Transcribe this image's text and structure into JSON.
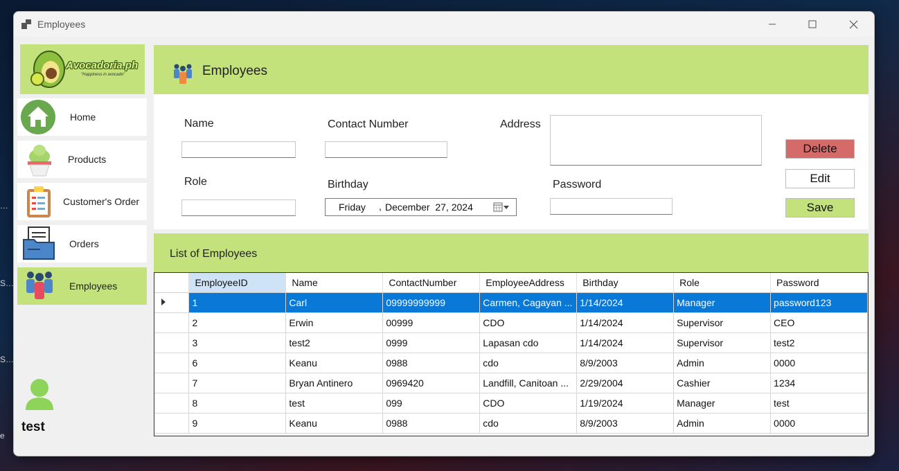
{
  "window": {
    "title": "Employees"
  },
  "sidebar": {
    "logo": {
      "brand": "Avocadoria.ph",
      "tagline": "\"Happiness in avocado\""
    },
    "items": [
      {
        "label": "Home",
        "icon": "home-icon"
      },
      {
        "label": "Products",
        "icon": "ice-cream-icon"
      },
      {
        "label": "Customer's Order",
        "icon": "clipboard-icon"
      },
      {
        "label": "Orders",
        "icon": "folder-icon"
      },
      {
        "label": "Employees",
        "icon": "people-icon",
        "active": true
      }
    ],
    "user": {
      "name": "test"
    }
  },
  "header": {
    "title": "Employees"
  },
  "form": {
    "name_label": "Name",
    "name_value": "",
    "contact_label": "Contact Number",
    "contact_value": "",
    "address_label": "Address",
    "address_value": "",
    "role_label": "Role",
    "role_value": "",
    "birthday_label": "Birthday",
    "birthday_day": "Friday",
    "birthday_sep": ",",
    "birthday_date": "December  27, 2024",
    "password_label": "Password",
    "password_value": "",
    "delete_label": "Delete",
    "edit_label": "Edit",
    "save_label": "Save"
  },
  "list": {
    "title": "List of Employees",
    "columns": [
      "EmployeeID",
      "Name",
      "ContactNumber",
      "EmployeeAddress",
      "Birthday",
      "Role",
      "Password"
    ],
    "rows": [
      [
        "1",
        "Carl",
        "09999999999",
        "Carmen, Cagayan ...",
        "1/14/2024",
        "Manager",
        "password123"
      ],
      [
        "2",
        "Erwin",
        "00999",
        "CDO",
        "1/14/2024",
        "Supervisor",
        "CEO"
      ],
      [
        "3",
        "test2",
        "0999",
        "Lapasan cdo",
        "1/14/2024",
        "Supervisor",
        "test2"
      ],
      [
        "6",
        "Keanu",
        "0988",
        "cdo",
        "8/9/2003",
        "Admin",
        "0000"
      ],
      [
        "7",
        "Bryan Antinero",
        "0969420",
        "Landfill, Canitoan ...",
        "2/29/2004",
        "Cashier",
        "1234"
      ],
      [
        "8",
        "test",
        "099",
        "CDO",
        "1/19/2024",
        "Manager",
        "test"
      ],
      [
        "9",
        "Keanu",
        "0988",
        "cdo",
        "8/9/2003",
        "Admin",
        "0000"
      ]
    ],
    "selected_row": 0
  },
  "colors": {
    "accent_green": "#c3e27b",
    "delete_red": "#d46a6a",
    "selection_blue": "#0a78d7"
  }
}
